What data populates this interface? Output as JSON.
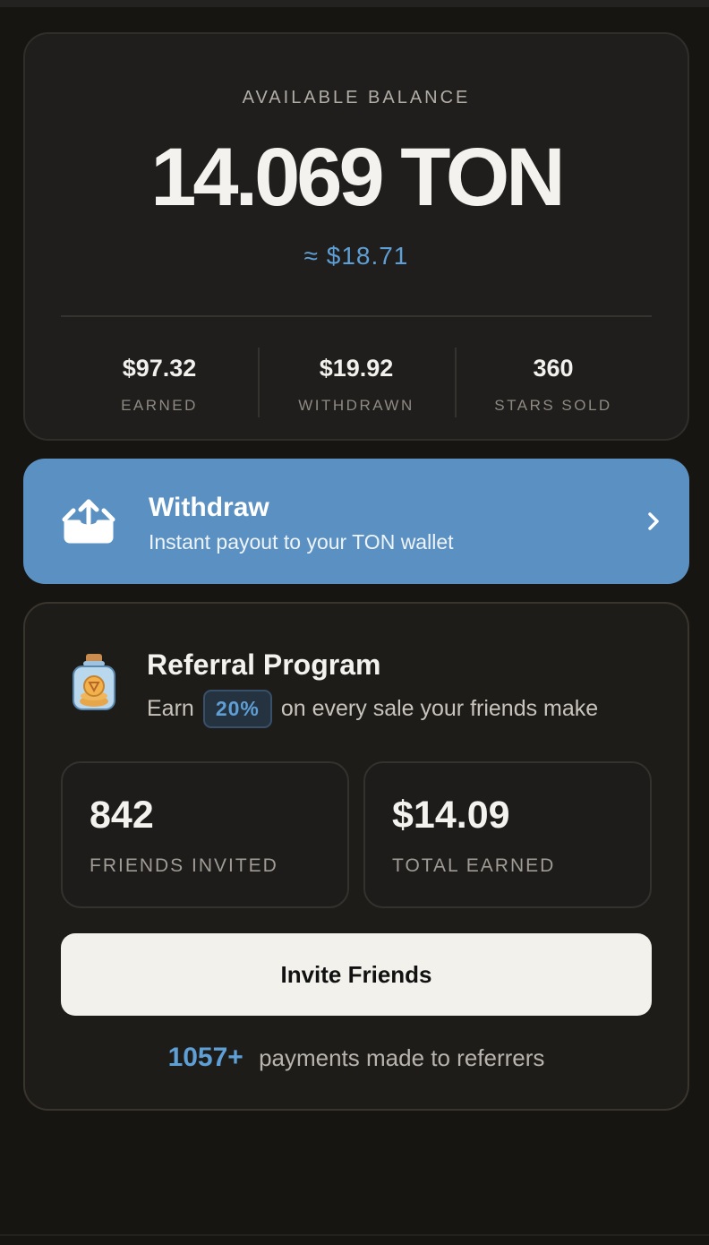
{
  "balance": {
    "label": "AVAILABLE BALANCE",
    "amount": "14.069 TON",
    "usd": "≈ $18.71",
    "stats": [
      {
        "value": "$97.32",
        "label": "EARNED"
      },
      {
        "value": "$19.92",
        "label": "WITHDRAWN"
      },
      {
        "value": "360",
        "label": "STARS SOLD"
      }
    ]
  },
  "withdraw": {
    "title": "Withdraw",
    "subtitle": "Instant payout to your TON wallet",
    "icon": "upload-tray-icon",
    "chevron": "chevron-right-icon"
  },
  "referral": {
    "icon": "coin-jar-icon",
    "title": "Referral Program",
    "sub_prefix": "Earn",
    "percent": "20%",
    "sub_suffix": "on every sale your friends make",
    "stats": [
      {
        "value": "842",
        "label": "FRIENDS INVITED"
      },
      {
        "value": "$14.09",
        "label": "TOTAL EARNED"
      }
    ],
    "invite_label": "Invite Friends",
    "payments_count": "1057+",
    "payments_text": "payments made to referrers"
  },
  "colors": {
    "accent": "#5e9fd6",
    "withdraw_bg": "#5b91c2",
    "background": "#161512",
    "card": "#1f1e1c"
  }
}
